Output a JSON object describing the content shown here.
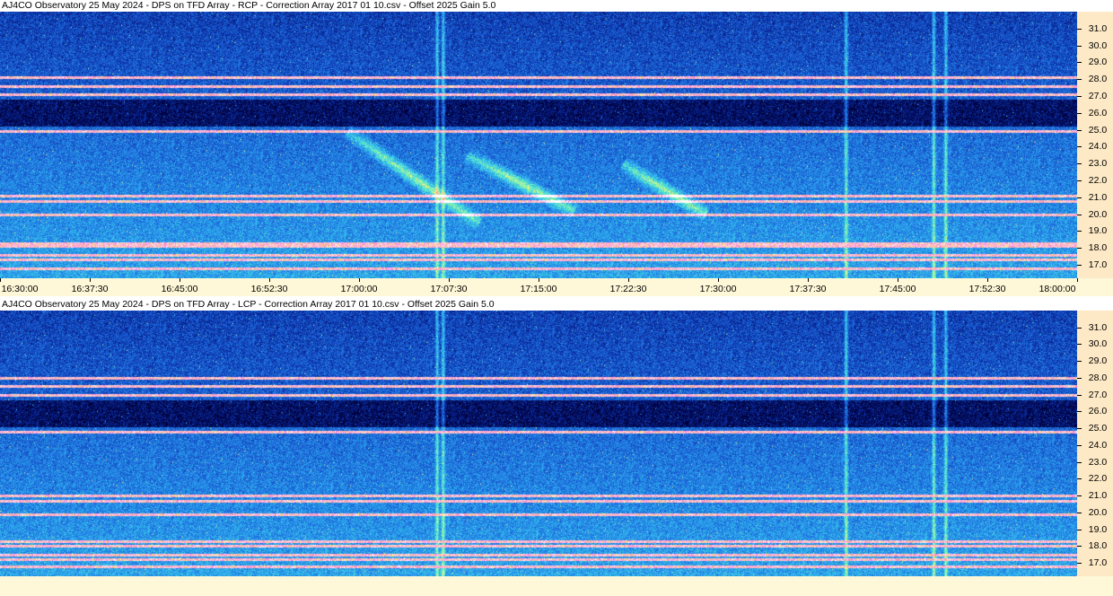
{
  "chart_data": [
    {
      "type": "heatmap",
      "title": "AJ4CO Observatory 25 May 2024  -  DPS on TFD Array  -  RCP  -  Correction Array 2017 01 10.csv  -  Offset 2025  Gain 5.0",
      "x_ticks": [
        "16:30:00",
        "16:37:30",
        "16:45:00",
        "16:52:30",
        "17:00:00",
        "17:07:30",
        "17:15:00",
        "17:22:30",
        "17:30:00",
        "17:37:30",
        "17:45:00",
        "17:52:30",
        "18:00:00"
      ],
      "xlim": [
        "16:30:00",
        "18:00:00"
      ],
      "y_ticks": [
        "31.0",
        "30.0",
        "29.0",
        "28.0",
        "27.0",
        "26.0",
        "25.0",
        "24.0",
        "23.0",
        "22.0",
        "21.0",
        "20.0",
        "19.0",
        "18.0",
        "17.0"
      ],
      "ylim": [
        16.2,
        32.0
      ],
      "y_axis_side": "right",
      "colormap": [
        "#00003a",
        "#0b2fa8",
        "#1f6fe0",
        "#2fb5f0",
        "#5ff0c8",
        "#f8f870",
        "#ff7ad8",
        "#ffffff"
      ],
      "horizontal_bands_mhz": [
        16.8,
        17.3,
        17.6,
        18.1,
        18.3,
        20.0,
        20.8,
        21.1,
        24.9,
        27.1,
        28.1,
        27.6
      ],
      "vertical_lines_time": [
        "17:06:30",
        "17:07:00",
        "17:40:40",
        "17:48:00",
        "17:49:00"
      ],
      "dark_band_mhz": [
        25.2,
        26.8
      ],
      "bursts": [
        {
          "t_start": "16:59:00",
          "f_start": 24.9,
          "t_end": "17:10:00",
          "f_end": 19.5
        },
        {
          "t_start": "17:09:00",
          "f_start": 23.5,
          "t_end": "17:18:00",
          "f_end": 20.2
        },
        {
          "t_start": "17:22:00",
          "f_start": 23.0,
          "t_end": "17:29:00",
          "f_end": 20.0
        }
      ]
    },
    {
      "type": "heatmap",
      "title": "AJ4CO Observatory 25 May 2024  -  DPS on TFD Array  -  LCP  -  Correction Array 2017 01 10.csv  -  Offset 2025  Gain 5.0",
      "x_ticks": [],
      "xlim": [
        "16:30:00",
        "18:00:00"
      ],
      "y_ticks": [
        "31.0",
        "30.0",
        "29.0",
        "28.0",
        "27.0",
        "26.0",
        "25.0",
        "24.0",
        "23.0",
        "22.0",
        "21.0",
        "20.0",
        "19.0",
        "18.0",
        "17.0"
      ],
      "ylim": [
        16.2,
        32.0
      ],
      "y_axis_side": "right",
      "colormap": [
        "#00003a",
        "#0b2fa8",
        "#1f6fe0",
        "#2fb5f0",
        "#5ff0c8",
        "#f8f870",
        "#ff7ad8",
        "#ffffff"
      ],
      "horizontal_bands_mhz": [
        16.8,
        17.2,
        17.5,
        18.0,
        18.3,
        19.9,
        20.7,
        21.0,
        24.8,
        27.0,
        28.0,
        27.5
      ],
      "vertical_lines_time": [
        "17:06:30",
        "17:07:00",
        "17:40:40",
        "17:48:00",
        "17:49:00"
      ],
      "dark_band_mhz": [
        25.1,
        26.7
      ],
      "bursts": []
    }
  ]
}
